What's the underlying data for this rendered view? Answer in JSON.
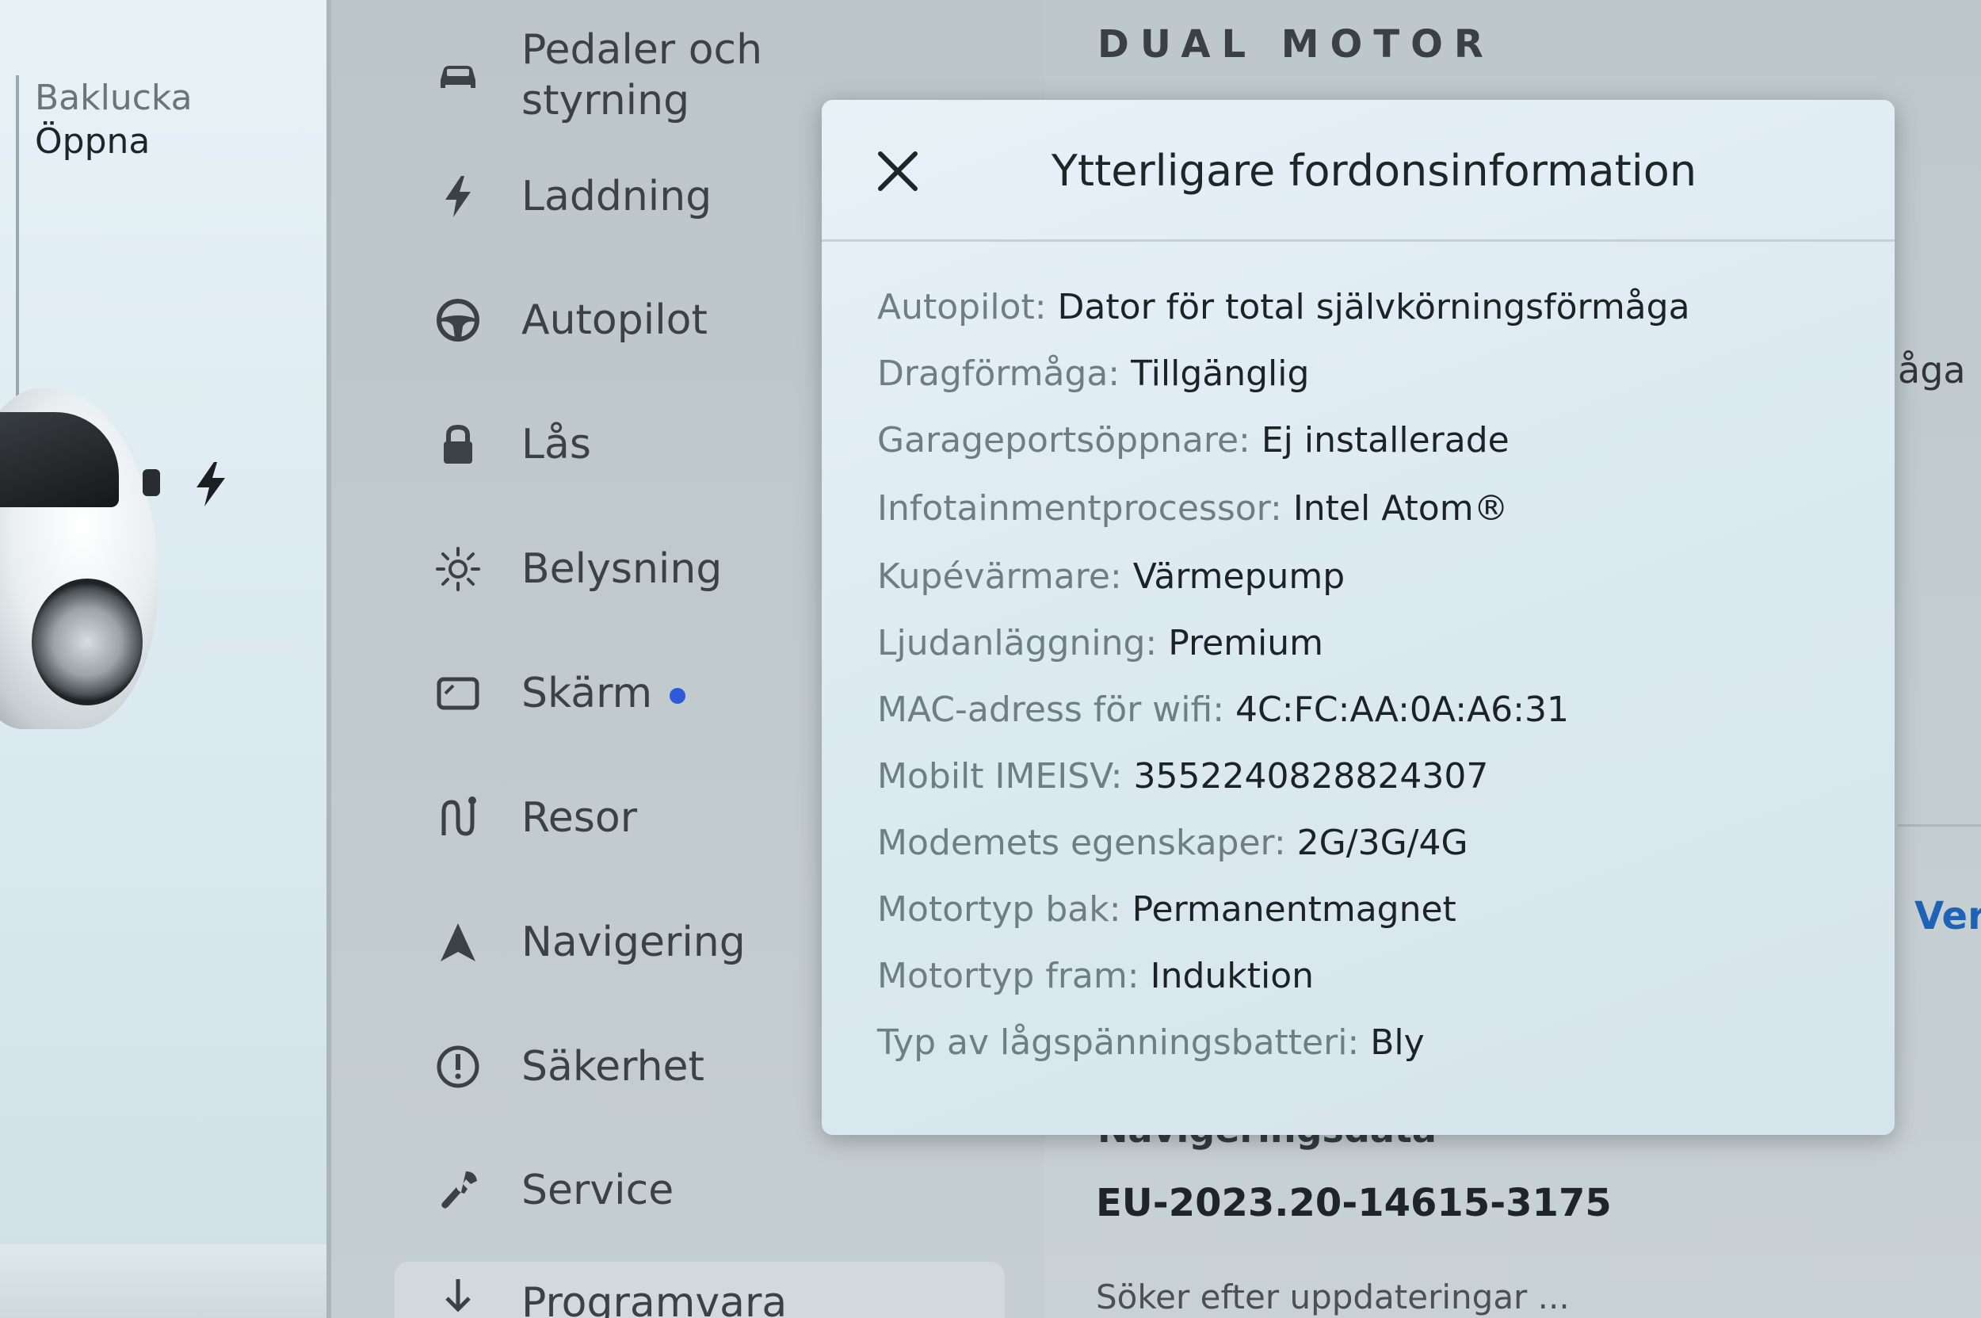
{
  "car_panel": {
    "trunk_title": "Baklucka",
    "trunk_action": "Öppna"
  },
  "menu": {
    "items": [
      {
        "label": "Pedaler och\nstyrning",
        "icon": "car-icon"
      },
      {
        "label": "Laddning",
        "icon": "bolt-icon"
      },
      {
        "label": "Autopilot",
        "icon": "steering-wheel-icon"
      },
      {
        "label": "Lås",
        "icon": "lock-icon"
      },
      {
        "label": "Belysning",
        "icon": "sun-icon"
      },
      {
        "label": "Skärm",
        "icon": "display-icon"
      },
      {
        "label": "Resor",
        "icon": "trips-icon"
      },
      {
        "label": "Navigering",
        "icon": "navigation-arrow-icon"
      },
      {
        "label": "Säkerhet",
        "icon": "alert-circle-icon"
      },
      {
        "label": "Service",
        "icon": "wrench-icon"
      },
      {
        "label": "Programvara",
        "icon": "download-icon"
      }
    ],
    "notification_color": "#2e59d9"
  },
  "background": {
    "brand": "DUAL MOTOR",
    "partial_text_right": "åga",
    "partial_link_right": "Ver",
    "navdata_label": "Navigeringsdata",
    "navdata_version": "EU-2023.20-14615-3175",
    "update_status": "Söker efter uppdateringar ..."
  },
  "modal": {
    "title": "Ytterligare fordonsinformation",
    "close_icon": "close-icon",
    "rows": [
      {
        "key": "Autopilot:",
        "value": "Dator för total självkörningsförmåga"
      },
      {
        "key": "Dragförmåga:",
        "value": "Tillgänglig"
      },
      {
        "key": "Garageportsöppnare:",
        "value": "Ej installerade"
      },
      {
        "key": "Infotainmentprocessor:",
        "value": "Intel Atom®"
      },
      {
        "key": "Kupévärmare:",
        "value": "Värmepump"
      },
      {
        "key": "Ljudanläggning:",
        "value": "Premium"
      },
      {
        "key": "MAC-adress för wifi:",
        "value": "4C:FC:AA:0A:A6:31"
      },
      {
        "key": "Mobilt IMEISV:",
        "value": "3552240828824307"
      },
      {
        "key": "Modemets egenskaper:",
        "value": "2G/3G/4G"
      },
      {
        "key": "Motortyp bak:",
        "value": "Permanentmagnet"
      },
      {
        "key": "Motortyp fram:",
        "value": "Induktion"
      },
      {
        "key": "Typ av lågspänningsbatteri:",
        "value": "Bly"
      }
    ]
  }
}
